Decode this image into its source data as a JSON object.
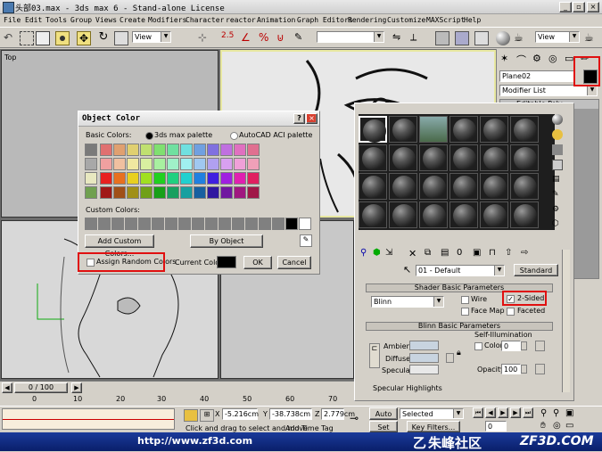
{
  "window": {
    "title": "头部03.max - 3ds max 6 - Stand-alone License"
  },
  "menu": [
    "File",
    "Edit",
    "Tools",
    "Group",
    "Views",
    "Create",
    "Modifiers",
    "Character",
    "reactor",
    "Animation",
    "Graph Editors",
    "Rendering",
    "Customize",
    "MAXScript",
    "Help"
  ],
  "toolbar": {
    "view_dropdown": "View",
    "view_dropdown2": "View"
  },
  "viewports": {
    "top_label": "Top"
  },
  "command_panel": {
    "object_name": "Plane02",
    "modifier_list": "Modifier List",
    "stack_item": "Editable Poly"
  },
  "object_color": {
    "title": "Object Color",
    "basic_colors_label": "Basic Colors:",
    "palette_max": "3ds max palette",
    "palette_acad": "AutoCAD ACI palette",
    "custom_colors_label": "Custom Colors:",
    "add_custom": "Add Custom Colors...",
    "by_object": "By Object",
    "assign_random": "Assign Random Colors",
    "current_color_label": "Current Color:",
    "ok": "OK",
    "cancel": "Cancel",
    "current_color": "#000000",
    "palette_rows": [
      [
        "#7a7a7a",
        "#e07070",
        "#e0a070",
        "#e0d070",
        "#c0e070",
        "#80e070",
        "#70e0a0",
        "#70e0e0",
        "#70a0e0",
        "#8070e0",
        "#c070e0",
        "#e070c0",
        "#e07090"
      ],
      [
        "#a8a8a8",
        "#f0a0a0",
        "#f0c0a0",
        "#f0e8a0",
        "#d8f0a0",
        "#a8f0a0",
        "#a0f0c8",
        "#a0f0f0",
        "#a0c8f0",
        "#b0a0f0",
        "#d8a0f0",
        "#f0a0d8",
        "#f0a0b8"
      ],
      [
        "#e8e8c0",
        "#e82020",
        "#e87020",
        "#e8d020",
        "#a0e020",
        "#20d020",
        "#20d080",
        "#20d0d0",
        "#2080e0",
        "#4020e0",
        "#a020e0",
        "#e020b0",
        "#e02060"
      ],
      [
        "#70a050",
        "#a01818",
        "#a05018",
        "#a09018",
        "#70a018",
        "#18a018",
        "#18a060",
        "#18a0a0",
        "#1860a0",
        "#3018a0",
        "#7018a0",
        "#a01880",
        "#a01848"
      ]
    ],
    "custom_row": [
      "#808080",
      "#808080",
      "#808080",
      "#808080",
      "#808080",
      "#808080",
      "#808080",
      "#808080",
      "#808080",
      "#808080",
      "#808080",
      "#808080",
      "#808080",
      "#808080",
      "#808080",
      "#000000",
      "#ffffff"
    ]
  },
  "material_editor": {
    "material_name": "01 - Default",
    "type_button": "Standard",
    "shader_params_header": "Shader Basic Parameters",
    "shader": "Blinn",
    "wire": "Wire",
    "two_sided": "2-Sided",
    "face_map": "Face Map",
    "faceted": "Faceted",
    "blinn_params_header": "Blinn Basic Parameters",
    "self_illum": "Self-Illumination",
    "color_label": "Color",
    "color_value": "0",
    "ambient": "Ambient:",
    "diffuse": "Diffuse:",
    "specular": "Specular:",
    "opacity_label": "Opacity:",
    "opacity_value": "100",
    "spec_highlights": "Specular Highlights"
  },
  "timeline": {
    "frame": "0 / 100",
    "ticks": [
      "0",
      "10",
      "20",
      "30",
      "40",
      "50",
      "60",
      "70"
    ]
  },
  "status": {
    "x_label": "X",
    "x": "-5.216cm",
    "y_label": "Y",
    "y": "-38.738cm",
    "z_label": "Z",
    "z": "2.779cm",
    "auto_key": "Auto Key",
    "selected": "Selected",
    "set_key": "Set Key",
    "key_filters": "Key Filters...",
    "prompt": "Click and drag to select and move",
    "add_time_tag": "Add Time Tag",
    "frame_value": "0"
  },
  "watermark": {
    "url": "http://www.zf3d.com",
    "cn": "朱峰社区",
    "brand": "ZF3D.COM"
  }
}
